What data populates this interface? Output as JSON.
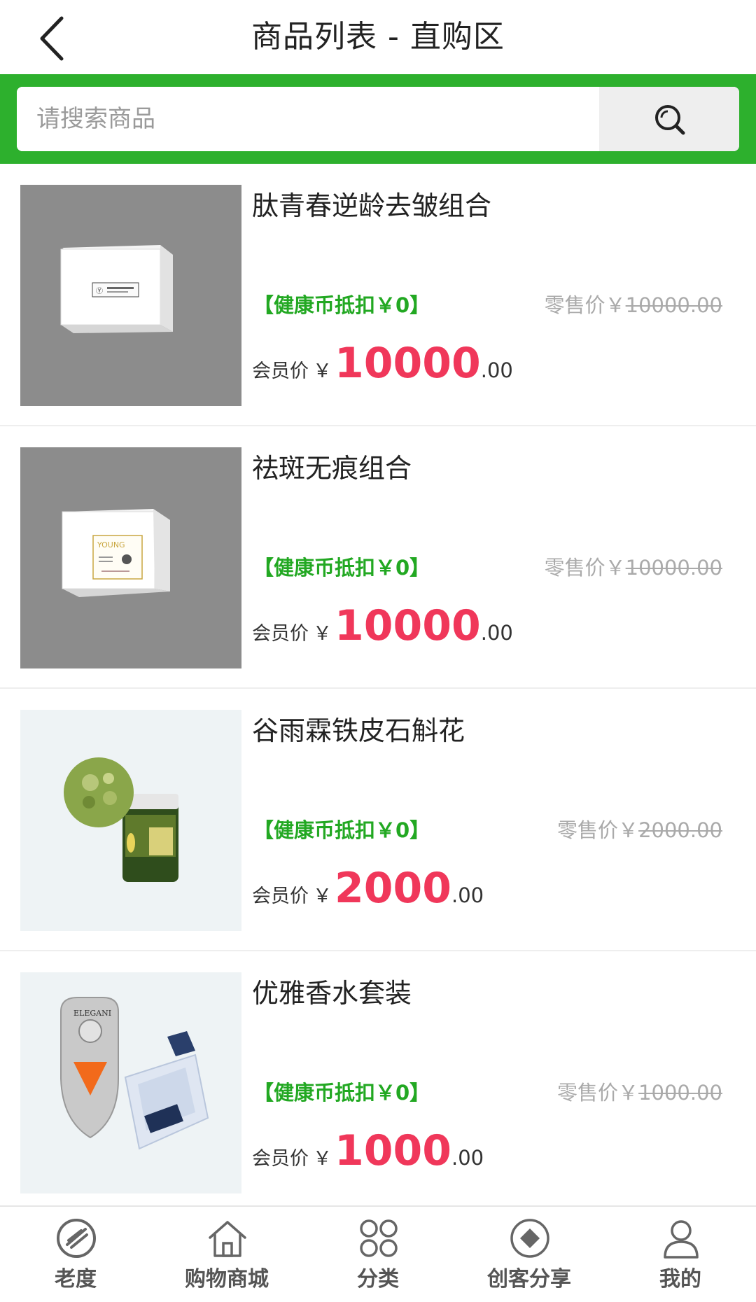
{
  "header": {
    "title": "商品列表 - 直购区",
    "back_icon": "chevron-left-icon"
  },
  "search": {
    "placeholder": "请搜索商品",
    "button_icon": "search-icon"
  },
  "colors": {
    "accent_green": "#2db02d",
    "coin_green": "#22a822",
    "price_red": "#f0375a",
    "muted_gray": "#aaaaaa"
  },
  "products": [
    {
      "name": "肽青春逆龄去皱组合",
      "coin_label": "【健康币抵扣￥0】",
      "retail_label": "零售价￥",
      "retail_value": "10000.00",
      "member_label": "会员价",
      "yen": "￥",
      "price_int": "10000",
      "price_dec": ".00"
    },
    {
      "name": "祛斑无痕组合",
      "coin_label": "【健康币抵扣￥0】",
      "retail_label": "零售价￥",
      "retail_value": "10000.00",
      "member_label": "会员价",
      "yen": "￥",
      "price_int": "10000",
      "price_dec": ".00"
    },
    {
      "name": "谷雨霖铁皮石斛花",
      "coin_label": "【健康币抵扣￥0】",
      "retail_label": "零售价￥",
      "retail_value": "2000.00",
      "member_label": "会员价",
      "yen": "￥",
      "price_int": "2000",
      "price_dec": ".00"
    },
    {
      "name": "优雅香水套装",
      "coin_label": "【健康币抵扣￥0】",
      "retail_label": "零售价￥",
      "retail_value": "1000.00",
      "member_label": "会员价",
      "yen": "￥",
      "price_int": "1000",
      "price_dec": ".00"
    }
  ],
  "tabbar": [
    {
      "label": "老度",
      "icon": "laodu-logo-icon"
    },
    {
      "label": "购物商城",
      "icon": "home-icon"
    },
    {
      "label": "分类",
      "icon": "category-icon"
    },
    {
      "label": "创客分享",
      "icon": "share-diamond-icon"
    },
    {
      "label": "我的",
      "icon": "user-icon"
    }
  ]
}
